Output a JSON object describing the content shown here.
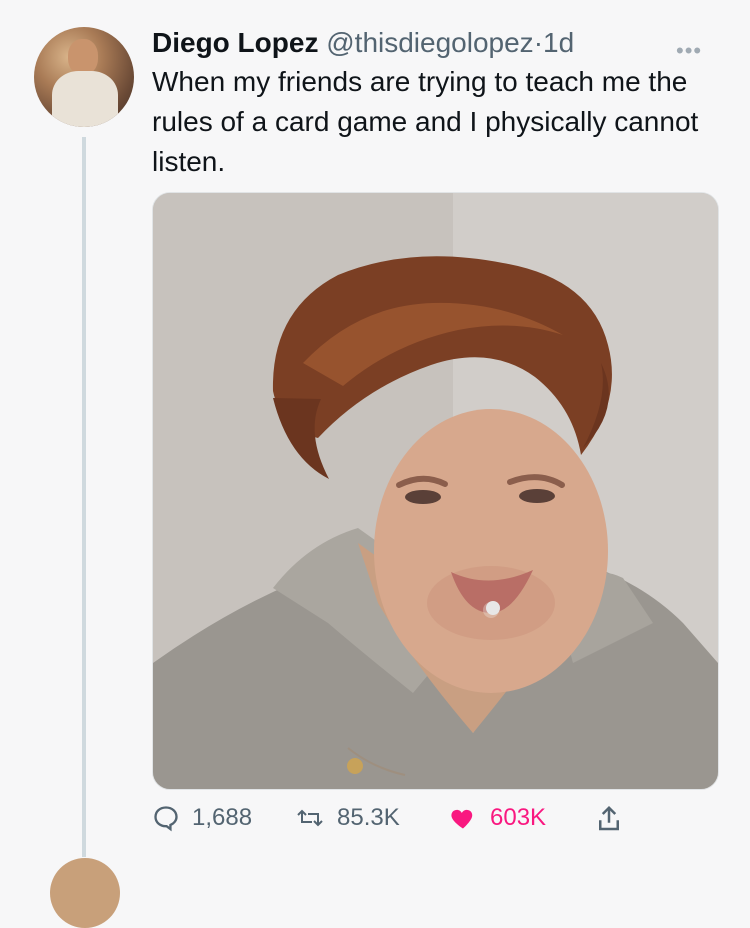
{
  "tweet": {
    "author_name": "Diego Lopez",
    "handle": "@thisdiegolopez",
    "separator": "·",
    "time": "1d",
    "more_icon": "more-icon",
    "text": "When my friends are trying to teach me the rules of a card game and I physically cannot listen.",
    "media_alt": "tearful-woman-photo"
  },
  "actions": {
    "reply_count": "1,688",
    "retweet_count": "85.3K",
    "like_count": "603K",
    "reply_icon": "reply-icon",
    "retweet_icon": "retweet-icon",
    "like_icon": "heart-icon",
    "share_icon": "share-icon",
    "like_color": "#f91880"
  }
}
